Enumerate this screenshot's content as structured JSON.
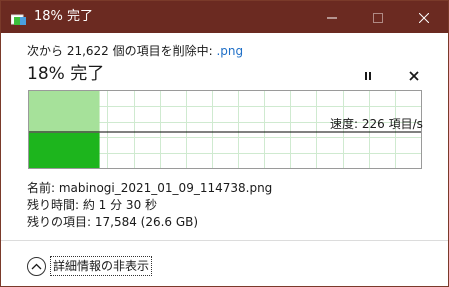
{
  "window": {
    "title": "18% 完了",
    "minimize_icon": "minimize-icon",
    "maximize_icon": "maximize-icon",
    "close_icon": "close-icon"
  },
  "status": {
    "prefix": "次から 21,622 個の項目を削除中: ",
    "extension": ".png"
  },
  "progress": {
    "heading": "18% 完了",
    "percent": 18,
    "pause_icon": "pause-icon",
    "cancel_icon": "cancel-icon"
  },
  "speed": {
    "label": "速度: 226 項目/s"
  },
  "details": {
    "name": "名前:  mabinogi_2021_01_09_114738.png",
    "time_remaining": "残り時間:  約 1 分 30 秒",
    "items_remaining": "残りの項目:  17,584 (26.6 GB)"
  },
  "footer": {
    "toggle_label": "詳細情報の非表示",
    "toggle_icon": "chevron-up-icon"
  },
  "colors": {
    "titlebar": "#6b2a21",
    "progress_done": "#1db51d",
    "progress_band": "#a6e19a",
    "grid": "#cfead0",
    "speed_line": "#000000",
    "link": "#1f6fc7"
  }
}
